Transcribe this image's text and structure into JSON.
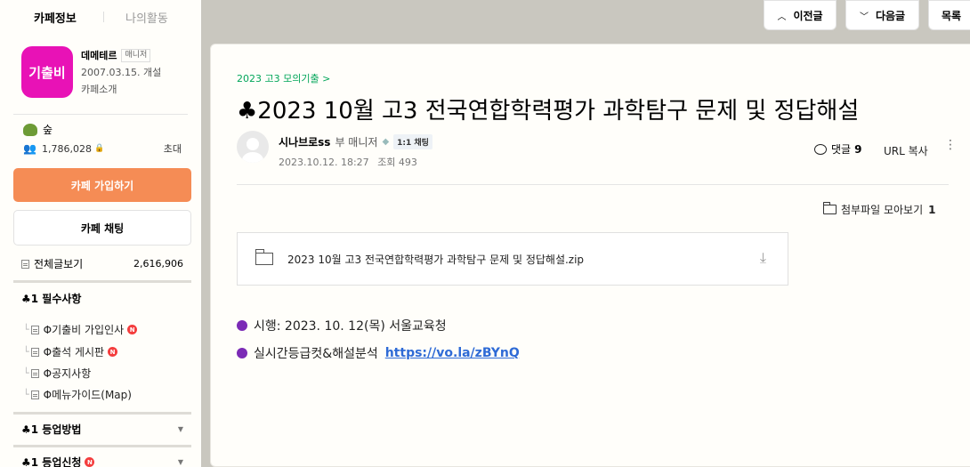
{
  "sidebar": {
    "tabs": [
      "카페정보",
      "나의활동"
    ],
    "cafe": {
      "logo_text": "기출비",
      "manager_name": "데메테르",
      "manager_badge": "매니저",
      "founded": "2007.03.15. 개설",
      "intro": "카페소개",
      "level": "숲",
      "member_count": "1,786,028",
      "invite": "초대"
    },
    "join_button": "카페 가입하기",
    "chat_button": "카페 채팅",
    "all_posts": {
      "label": "전체글보기",
      "count": "2,616,906"
    },
    "sections": [
      {
        "title": "1 필수사항"
      },
      {
        "title": "1 등업방법"
      },
      {
        "title": "1 등업신청"
      }
    ],
    "section_icon": "♣",
    "sub_items": [
      {
        "label": "Φ기출비 가입인사",
        "new": "N"
      },
      {
        "label": "Φ출석 게시판",
        "new": "N"
      },
      {
        "label": "Φ공지사항"
      },
      {
        "label": "Φ메뉴가이드(Map)"
      }
    ],
    "new_badge": "N"
  },
  "nav": {
    "prev": "이전글",
    "next": "다음글",
    "list": "목록"
  },
  "article": {
    "board": "2023 고3 모의기출 >",
    "title": "♣2023 10월 고3 전국연합학력평가 과학탐구 문제 및 정답해설",
    "author": "시나브로ss",
    "author_role": "부 매니저",
    "chat_label": "1:1 채팅",
    "date": "2023.10.12. 18:27",
    "views": "조회 493",
    "comment_label": "댓글",
    "comment_count": "9",
    "url_copy": "URL 복사",
    "attach_all": "첨부파일 모아보기",
    "attach_count": "1",
    "file_name": "2023 10월 고3 전국연합학력평가 과학탐구 문제 및 정답해설.zip",
    "lines": [
      {
        "text": "시행: 2023. 10. 12(목) 서울교육청"
      },
      {
        "text": "실시간등급컷&해설분석",
        "link": "https://vo.la/zBYnQ"
      }
    ]
  },
  "colors": {
    "join_button": "#f58c55",
    "logo": "#e812b6",
    "board_link": "#03a65a",
    "bullet": "#7b2bb6",
    "link": "#2f6bd6",
    "new_badge": "#f43d3d"
  }
}
